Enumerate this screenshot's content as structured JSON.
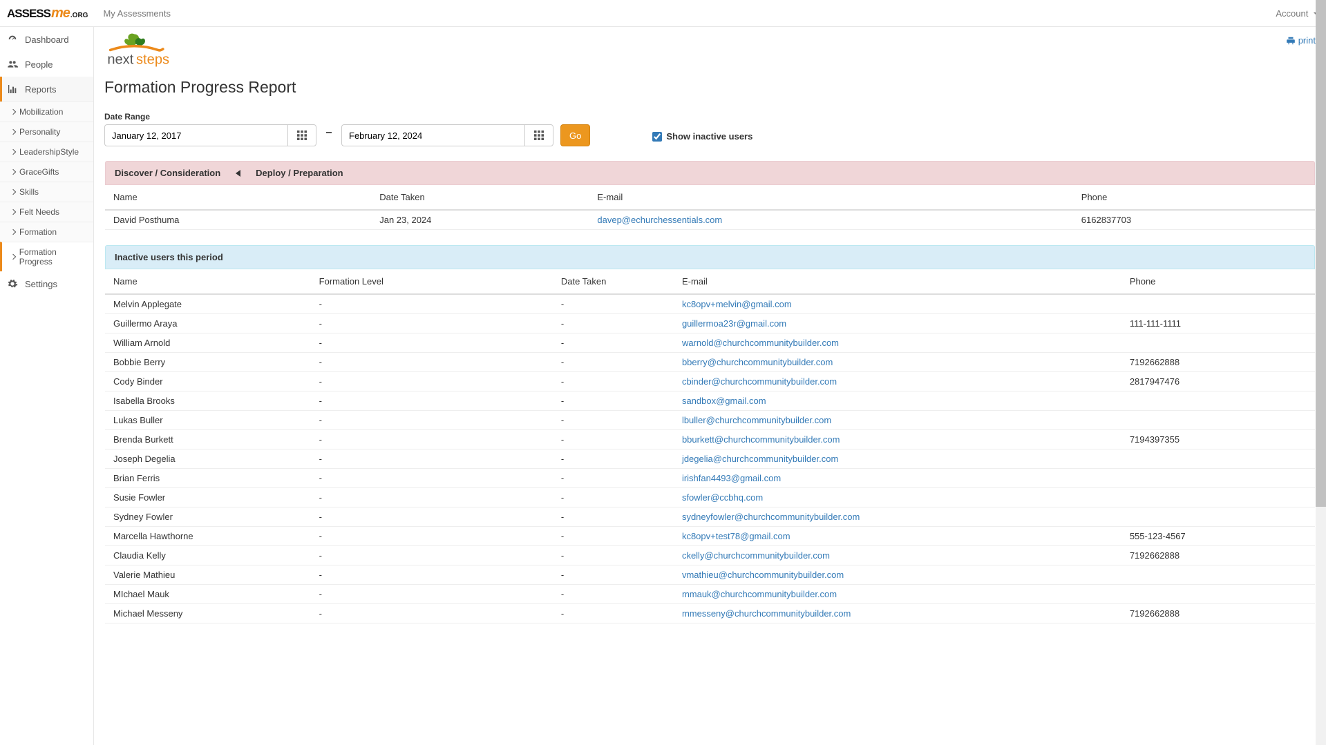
{
  "nav": {
    "my_assessments": "My Assessments",
    "account": "Account"
  },
  "sidebar": {
    "items": [
      {
        "label": "Dashboard"
      },
      {
        "label": "People"
      },
      {
        "label": "Reports"
      },
      {
        "label": "Settings"
      }
    ],
    "reports_submenu": [
      {
        "label": "Mobilization"
      },
      {
        "label": "Personality"
      },
      {
        "label": "LeadershipStyle"
      },
      {
        "label": "GraceGifts"
      },
      {
        "label": "Skills"
      },
      {
        "label": "Felt Needs"
      },
      {
        "label": "Formation"
      },
      {
        "label": "Formation Progress"
      }
    ]
  },
  "page": {
    "title": "Formation Progress Report",
    "print": "print"
  },
  "filters": {
    "date_range_label": "Date Range",
    "date_from": "January 12, 2017",
    "date_to": "February 12, 2024",
    "go": "Go",
    "show_inactive_label": "Show inactive users",
    "show_inactive_checked": true
  },
  "progress_panel": {
    "heading_left": "Discover / Consideration",
    "heading_right": "Deploy / Preparation",
    "columns": {
      "name": "Name",
      "date": "Date Taken",
      "email": "E-mail",
      "phone": "Phone"
    },
    "rows": [
      {
        "name": "David Posthuma",
        "date": "Jan 23, 2024",
        "email": "davep@echurchessentials.com",
        "phone": "6162837703"
      }
    ]
  },
  "inactive_panel": {
    "heading": "Inactive users this period",
    "columns": {
      "name": "Name",
      "level": "Formation Level",
      "date": "Date Taken",
      "email": "E-mail",
      "phone": "Phone"
    },
    "rows": [
      {
        "name": "Melvin Applegate",
        "level": "-",
        "date": "-",
        "email": "kc8opv+melvin@gmail.com",
        "phone": ""
      },
      {
        "name": "Guillermo Araya",
        "level": "-",
        "date": "-",
        "email": "guillermoa23r@gmail.com",
        "phone": "111-111-1111"
      },
      {
        "name": "William Arnold",
        "level": "-",
        "date": "-",
        "email": "warnold@churchcommunitybuilder.com",
        "phone": ""
      },
      {
        "name": "Bobbie Berry",
        "level": "-",
        "date": "-",
        "email": "bberry@churchcommunitybuilder.com",
        "phone": "7192662888"
      },
      {
        "name": "Cody Binder",
        "level": "-",
        "date": "-",
        "email": "cbinder@churchcommunitybuilder.com",
        "phone": "2817947476"
      },
      {
        "name": "Isabella Brooks",
        "level": "-",
        "date": "-",
        "email": "sandbox@gmail.com",
        "phone": ""
      },
      {
        "name": "Lukas Buller",
        "level": "-",
        "date": "-",
        "email": "lbuller@churchcommunitybuilder.com",
        "phone": ""
      },
      {
        "name": "Brenda Burkett",
        "level": "-",
        "date": "-",
        "email": "bburkett@churchcommunitybuilder.com",
        "phone": "7194397355"
      },
      {
        "name": "Joseph Degelia",
        "level": "-",
        "date": "-",
        "email": "jdegelia@churchcommunitybuilder.com",
        "phone": ""
      },
      {
        "name": "Brian Ferris",
        "level": "-",
        "date": "-",
        "email": "irishfan4493@gmail.com",
        "phone": ""
      },
      {
        "name": "Susie Fowler",
        "level": "-",
        "date": "-",
        "email": "sfowler@ccbhq.com",
        "phone": ""
      },
      {
        "name": "Sydney Fowler",
        "level": "-",
        "date": "-",
        "email": "sydneyfowler@churchcommunitybuilder.com",
        "phone": ""
      },
      {
        "name": "Marcella Hawthorne",
        "level": "-",
        "date": "-",
        "email": "kc8opv+test78@gmail.com",
        "phone": "555-123-4567"
      },
      {
        "name": "Claudia Kelly",
        "level": "-",
        "date": "-",
        "email": "ckelly@churchcommunitybuilder.com",
        "phone": "7192662888"
      },
      {
        "name": "Valerie Mathieu",
        "level": "-",
        "date": "-",
        "email": "vmathieu@churchcommunitybuilder.com",
        "phone": ""
      },
      {
        "name": "MIchael Mauk",
        "level": "-",
        "date": "-",
        "email": "mmauk@churchcommunitybuilder.com",
        "phone": ""
      },
      {
        "name": "Michael Messeny",
        "level": "-",
        "date": "-",
        "email": "mmesseny@churchcommunitybuilder.com",
        "phone": "7192662888"
      }
    ]
  }
}
